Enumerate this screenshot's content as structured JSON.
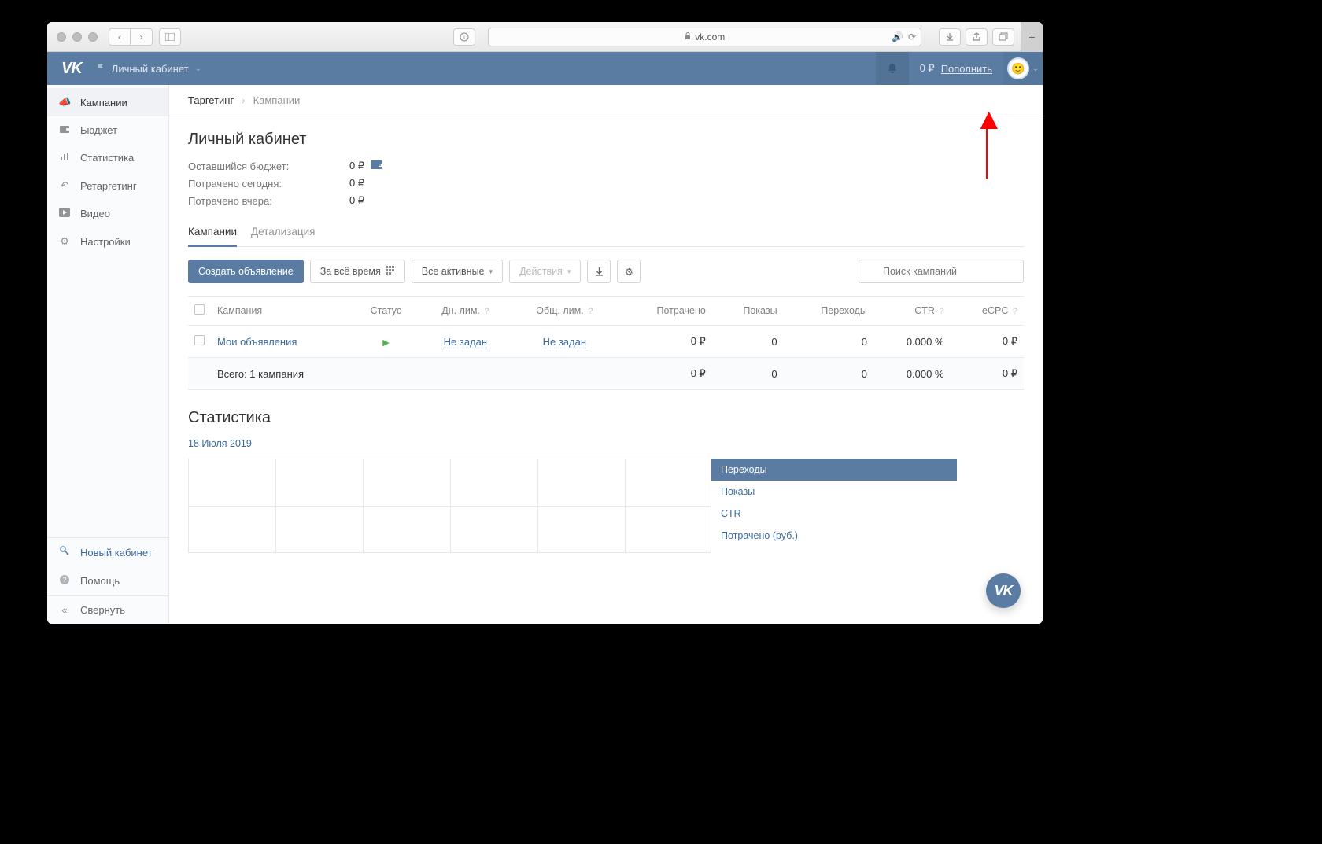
{
  "browser": {
    "url_host": "vk.com"
  },
  "header": {
    "cabinet_label": "Личный кабинет",
    "balance": "0 ₽",
    "replenish_label": "Пополнить"
  },
  "sidebar": {
    "items": [
      {
        "label": "Кампании",
        "icon": "megaphone"
      },
      {
        "label": "Бюджет",
        "icon": "wallet"
      },
      {
        "label": "Статистика",
        "icon": "bars"
      },
      {
        "label": "Ретаргетинг",
        "icon": "undo"
      },
      {
        "label": "Видео",
        "icon": "play"
      },
      {
        "label": "Настройки",
        "icon": "gear"
      }
    ],
    "new_cabinet": "Новый кабинет",
    "help": "Помощь",
    "collapse": "Свернуть"
  },
  "breadcrumb": {
    "root": "Таргетинг",
    "current": "Кампании"
  },
  "page": {
    "title": "Личный кабинет",
    "budget": {
      "remaining_label": "Оставшийся бюджет:",
      "remaining_value": "0 ₽",
      "spent_today_label": "Потрачено сегодня:",
      "spent_today_value": "0 ₽",
      "spent_yesterday_label": "Потрачено вчера:",
      "spent_yesterday_value": "0 ₽"
    },
    "tabs": {
      "campaigns": "Кампании",
      "details": "Детализация"
    },
    "toolbar": {
      "create_ad": "Создать объявление",
      "period": "За всё время",
      "filter": "Все активные",
      "actions": "Действия",
      "search_placeholder": "Поиск кампаний"
    },
    "table": {
      "headers": {
        "campaign": "Кампания",
        "status": "Статус",
        "daily_limit": "Дн. лим.",
        "total_limit": "Общ. лим.",
        "spent": "Потрачено",
        "impressions": "Показы",
        "clicks": "Переходы",
        "ctr": "CTR",
        "ecpc": "eCPC"
      },
      "rows": [
        {
          "name": "Мои объявления",
          "daily_limit": "Не задан",
          "total_limit": "Не задан",
          "spent": "0 ₽",
          "impressions": "0",
          "clicks": "0",
          "ctr": "0.000 %",
          "ecpc": "0 ₽"
        }
      ],
      "totals": {
        "label": "Всего: 1 кампания",
        "spent": "0 ₽",
        "impressions": "0",
        "clicks": "0",
        "ctr": "0.000 %",
        "ecpc": "0 ₽"
      }
    },
    "stats": {
      "title": "Статистика",
      "date": "18 Июля 2019",
      "legend": [
        "Переходы",
        "Показы",
        "CTR",
        "Потрачено (руб.)"
      ]
    }
  },
  "chart_data": {
    "type": "line",
    "title": "Статистика",
    "x": [
      "18 Июля 2019"
    ],
    "series": [
      {
        "name": "Переходы",
        "values": [
          0
        ]
      },
      {
        "name": "Показы",
        "values": [
          0
        ]
      },
      {
        "name": "CTR",
        "values": [
          0
        ]
      },
      {
        "name": "Потрачено (руб.)",
        "values": [
          0
        ]
      }
    ],
    "xlabel": "",
    "ylabel": "",
    "ylim": [
      0,
      1
    ]
  }
}
